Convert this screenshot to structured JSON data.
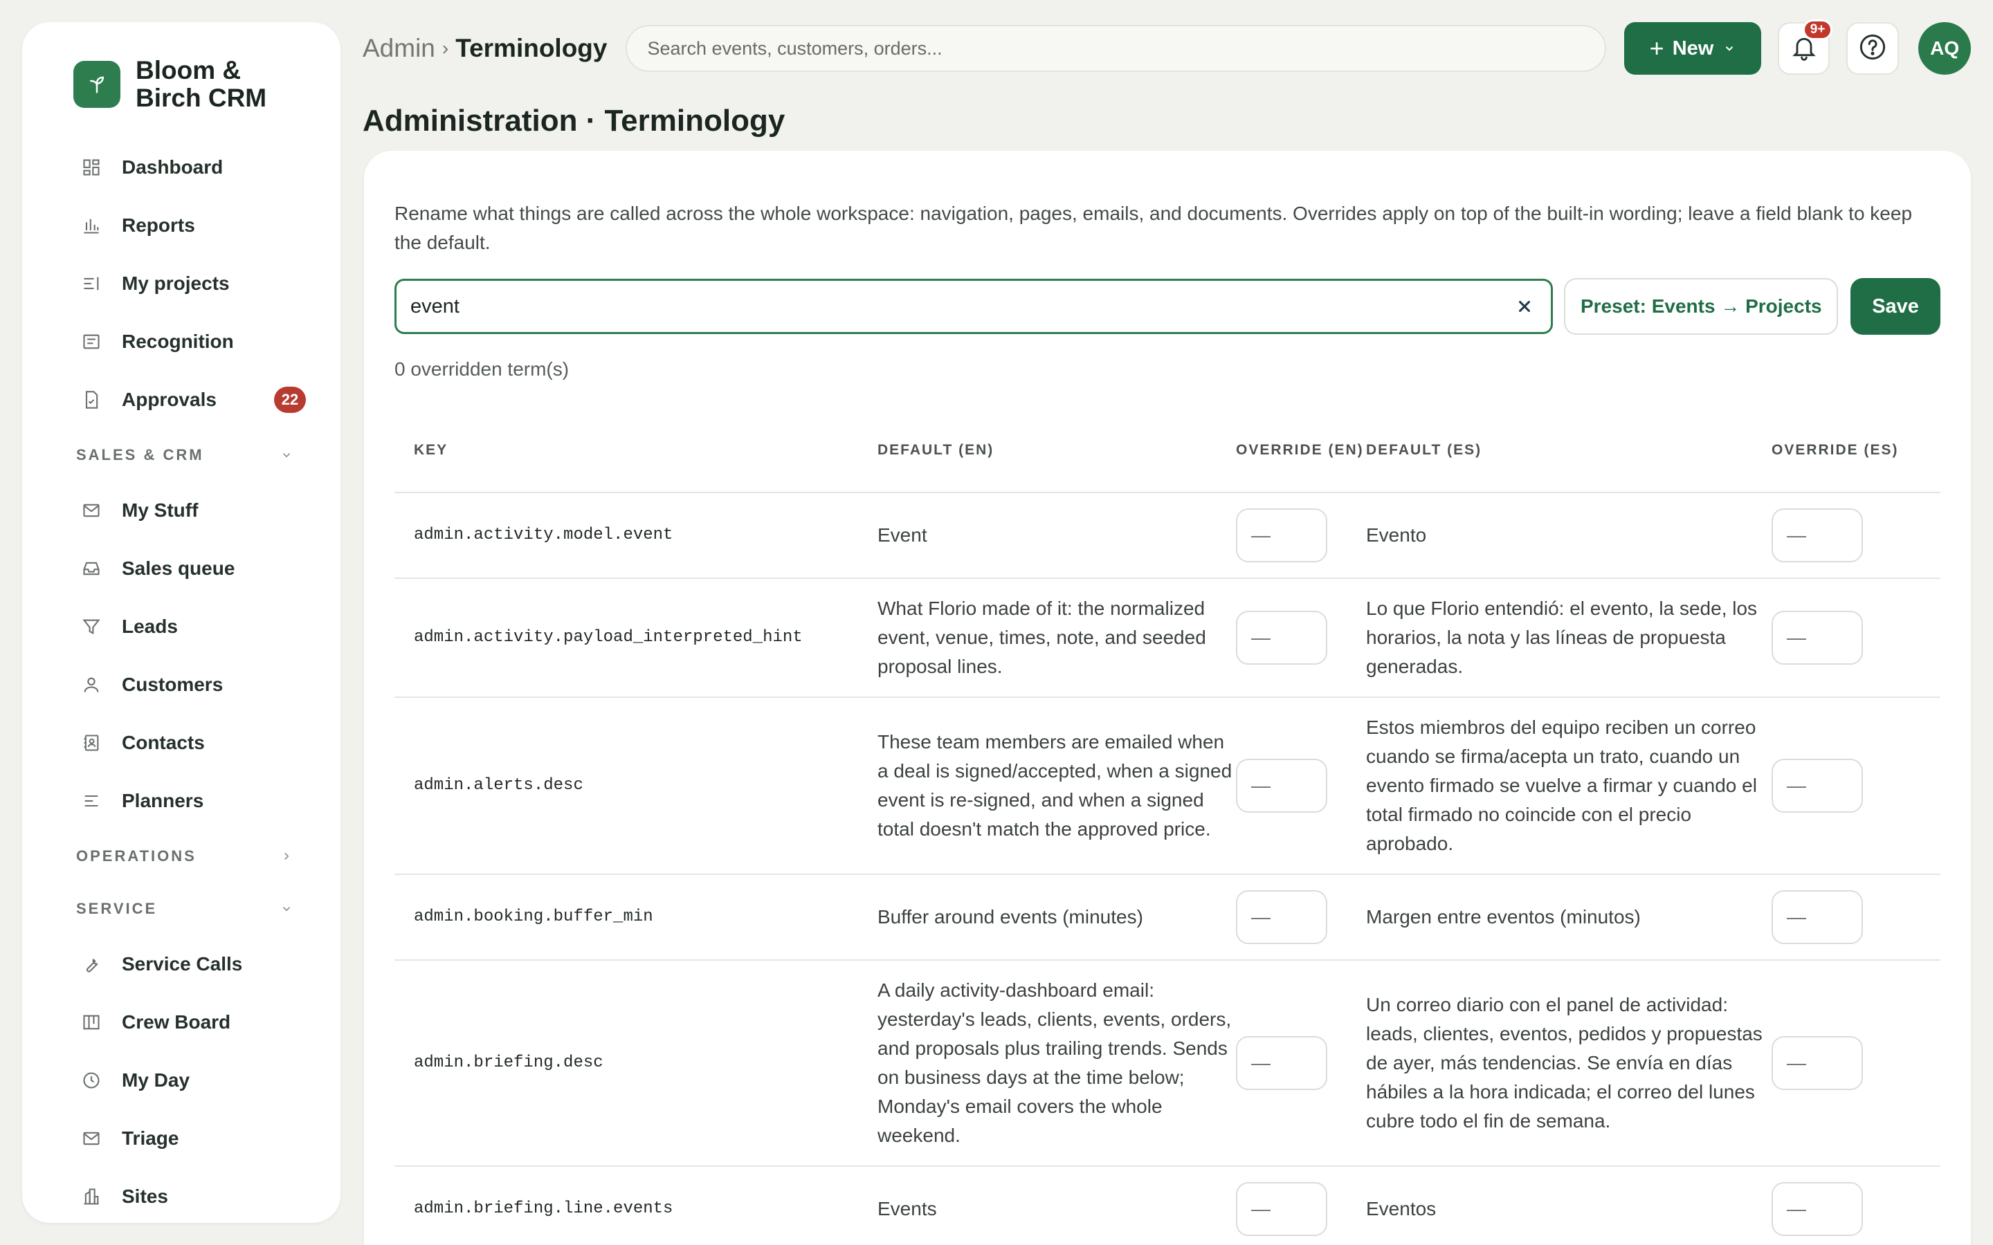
{
  "app": {
    "brand_name": "Bloom & Birch CRM"
  },
  "sidebar": {
    "items_top": [
      {
        "label": "Dashboard",
        "icon": "dashboard-icon"
      },
      {
        "label": "Reports",
        "icon": "bar-chart-icon"
      },
      {
        "label": "My projects",
        "icon": "list-icon"
      },
      {
        "label": "Recognition",
        "icon": "card-icon"
      },
      {
        "label": "Approvals",
        "icon": "document-check-icon",
        "badge": "22"
      }
    ],
    "section_sales": {
      "label": "SALES & CRM",
      "state": "expanded"
    },
    "items_sales": [
      {
        "label": "My Stuff",
        "icon": "mail-icon"
      },
      {
        "label": "Sales queue",
        "icon": "inbox-icon"
      },
      {
        "label": "Leads",
        "icon": "filter-icon"
      },
      {
        "label": "Customers",
        "icon": "user-icon"
      },
      {
        "label": "Contacts",
        "icon": "contact-book-icon"
      },
      {
        "label": "Planners",
        "icon": "lines-icon"
      }
    ],
    "section_operations": {
      "label": "OPERATIONS",
      "state": "collapsed"
    },
    "section_service": {
      "label": "SERVICE",
      "state": "expanded"
    },
    "items_service": [
      {
        "label": "Service Calls",
        "icon": "wrench-icon"
      },
      {
        "label": "Crew Board",
        "icon": "board-icon"
      },
      {
        "label": "My Day",
        "icon": "clock-icon"
      },
      {
        "label": "Triage",
        "icon": "mail-icon"
      },
      {
        "label": "Sites",
        "icon": "building-icon"
      }
    ]
  },
  "header": {
    "breadcrumb_parent": "Admin",
    "breadcrumb_sep": "›",
    "breadcrumb_current": "Terminology",
    "search_placeholder": "Search events, customers, orders...",
    "new_label": "New",
    "notification_badge": "9+",
    "avatar_initials": "AQ"
  },
  "main": {
    "page_title": "Administration · Terminology",
    "description": "Rename what things are called across the whole workspace: navigation, pages, emails, and documents. Overrides apply on top of the built-in wording; leave a field blank to keep the default.",
    "filter_value": "event",
    "preset_label": "Preset: Events → Projects",
    "save_label": "Save",
    "override_count": "0 overridden term(s)",
    "columns": {
      "key": "KEY",
      "default_en": "DEFAULT (EN)",
      "override_en": "OVERRIDE (EN)",
      "default_es": "DEFAULT (ES)",
      "override_es": "OVERRIDE (ES)"
    },
    "override_placeholder": "—",
    "rows": [
      {
        "key": "admin.activity.model.event",
        "default_en": "Event",
        "default_es": "Evento"
      },
      {
        "key": "admin.activity.payload_interpreted_hint",
        "default_en": "What Florio made of it: the normalized event, venue, times, note, and seeded proposal lines.",
        "default_es": "Lo que Florio entendió: el evento, la sede, los horarios, la nota y las líneas de propuesta generadas."
      },
      {
        "key": "admin.alerts.desc",
        "default_en": "These team members are emailed when a deal is signed/accepted, when a signed event is re-signed, and when a signed total doesn't match the approved price.",
        "default_es": "Estos miembros del equipo reciben un correo cuando se firma/acepta un trato, cuando un evento firmado se vuelve a firmar y cuando el total firmado no coincide con el precio aprobado."
      },
      {
        "key": "admin.booking.buffer_min",
        "default_en": "Buffer around events (minutes)",
        "default_es": "Margen entre eventos (minutos)"
      },
      {
        "key": "admin.briefing.desc",
        "default_en": "A daily activity-dashboard email: yesterday's leads, clients, events, orders, and proposals plus trailing trends. Sends on business days at the time below; Monday's email covers the whole weekend.",
        "default_es": "Un correo diario con el panel de actividad: leads, clientes, eventos, pedidos y propuestas de ayer, más tendencias. Se envía en días hábiles a la hora indicada; el correo del lunes cubre todo el fin de semana."
      },
      {
        "key": "admin.briefing.line.events",
        "default_en": "Events",
        "default_es": "Eventos"
      }
    ]
  },
  "colors": {
    "accent": "#1f6e45",
    "brand": "#2d7d4f",
    "badge": "#b83b32",
    "background": "#f1f1ed"
  }
}
